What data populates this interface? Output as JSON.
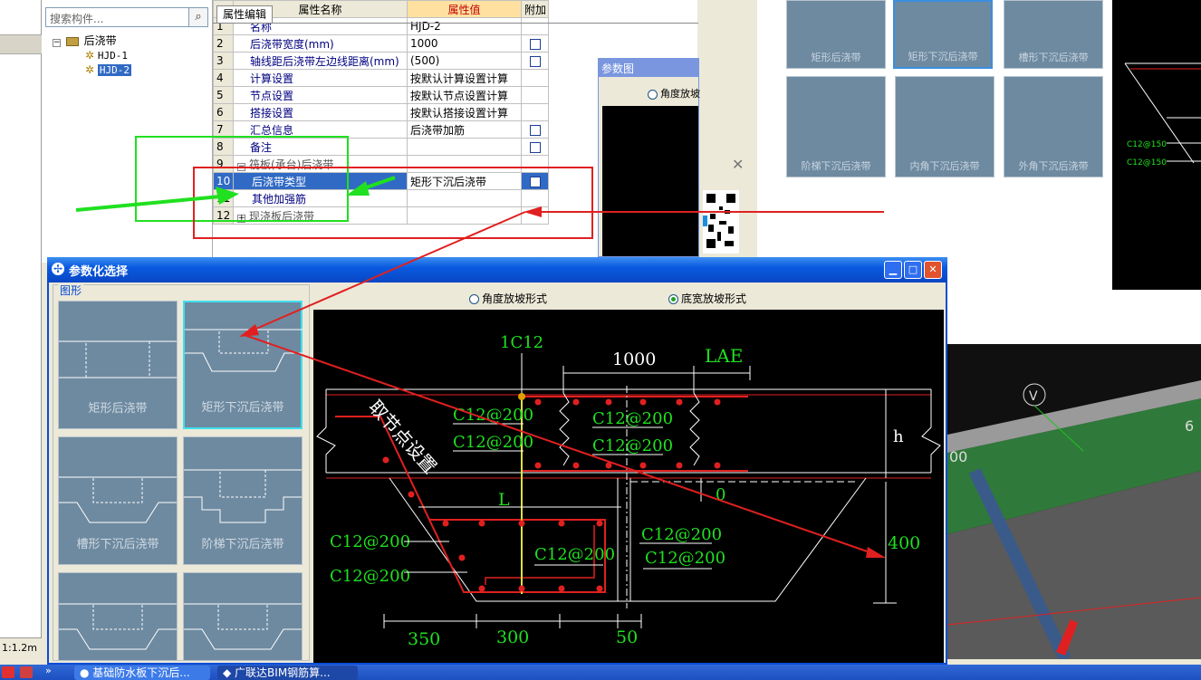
{
  "tree": {
    "search_placeholder": "搜索构件...",
    "root_label": "后浇带",
    "items": [
      "HJD-1",
      "HJD-2"
    ]
  },
  "props": {
    "tab_label": "属性编辑",
    "col_name": "属性名称",
    "col_value": "属性值",
    "col_extra": "附加",
    "rows": [
      {
        "n": "1",
        "name": "名称",
        "value": "HJD-2"
      },
      {
        "n": "2",
        "name": "后浇带宽度(mm)",
        "value": "1000"
      },
      {
        "n": "3",
        "name": "轴线距后浇带左边线距离(mm)",
        "value": "(500)"
      },
      {
        "n": "4",
        "name": "计算设置",
        "value": "按默认计算设置计算"
      },
      {
        "n": "5",
        "name": "节点设置",
        "value": "按默认节点设置计算"
      },
      {
        "n": "6",
        "name": "搭接设置",
        "value": "按默认搭接设置计算"
      },
      {
        "n": "7",
        "name": "汇总信息",
        "value": "后浇带加筋"
      },
      {
        "n": "8",
        "name": "备注",
        "value": ""
      },
      {
        "n": "9",
        "name": "筏板(承台)后浇带",
        "value": ""
      },
      {
        "n": "10",
        "name": "后浇带类型",
        "value": "矩形下沉后浇带"
      },
      {
        "n": "11",
        "name": "其他加强筋",
        "value": ""
      },
      {
        "n": "12",
        "name": "现浇板后浇带",
        "value": ""
      }
    ]
  },
  "small_dialog": {
    "title": "参数图",
    "radio": "角度放坡"
  },
  "right_thumbs": [
    "矩形后浇带",
    "矩形下沉后浇带",
    "槽形下沉后浇带",
    "阶梯下沉后浇带",
    "内角下沉后浇带",
    "外角下沉后浇带"
  ],
  "right_cad": {
    "labels": [
      "C12@150",
      "C12@150"
    ]
  },
  "view3d": {
    "label_v": "V",
    "label_00": "00",
    "label_6": "6"
  },
  "dialog": {
    "title": "参数化选择",
    "group_label": "图形",
    "shapes": [
      "矩形后浇带",
      "矩形下沉后浇带",
      "槽形下沉后浇带",
      "阶梯下沉后浇带"
    ],
    "radio_angle": "角度放坡形式",
    "radio_width": "底宽放坡形式"
  },
  "cad": {
    "top_bar": "1C12",
    "width": "1000",
    "lae": "LAE",
    "h": "h",
    "zero": "0",
    "depth": "400",
    "L": "L",
    "node_text": "取节点设置",
    "dim_350": "350",
    "dim_300": "300",
    "dim_50": "50",
    "rebars_top": [
      "C12@200",
      "C12@200",
      "C12@200",
      "C12@200"
    ],
    "rebars_bottom": [
      "C12@200",
      "C12@200",
      "C12@200",
      "C12@200",
      "C12@200"
    ]
  },
  "status": {
    "scale": "1:1.2m"
  },
  "taskbar": {
    "item1": "基础防水板下沉后...",
    "item2": "广联达BIM钢筋算..."
  }
}
